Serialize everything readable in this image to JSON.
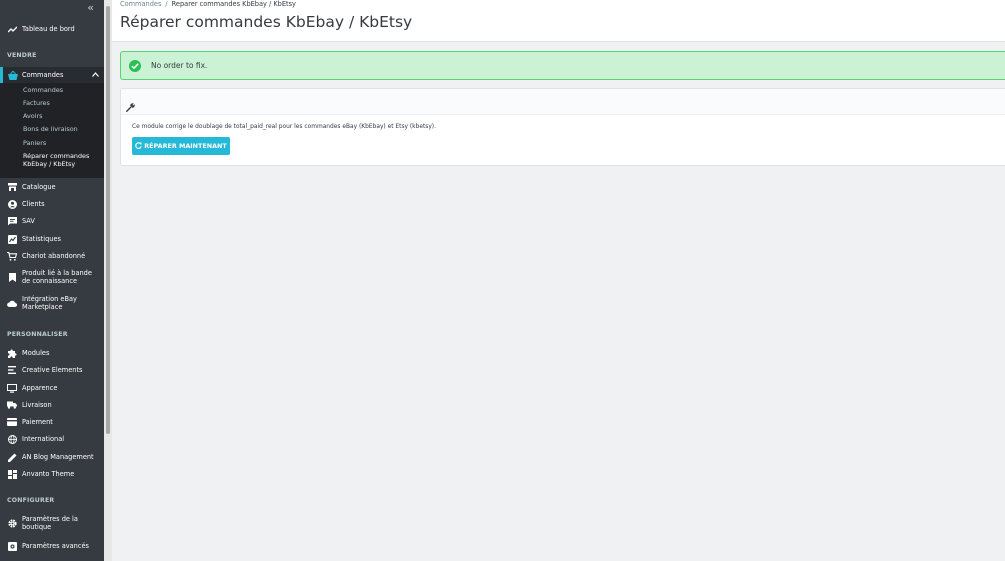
{
  "sidebar": {
    "collapse_icon": "«",
    "dashboard": "Tableau de bord",
    "sections": {
      "vendre": "VENDRE",
      "personnaliser": "PERSONNALISER",
      "configurer": "CONFIGURER"
    },
    "commandes": "Commandes",
    "submenu": [
      "Commandes",
      "Factures",
      "Avoirs",
      "Bons de livraison",
      "Paniers",
      "Réparer commandes KbEbay / KbEtsy"
    ],
    "vendre_items": [
      "Catalogue",
      "Clients",
      "SAV",
      "Statistiques",
      "Chariot abandonné",
      "Produit lié à la bande de connaissance",
      "Intégration eBay Marketplace"
    ],
    "personnaliser_items": [
      "Modules",
      "Creative Elements",
      "Apparence",
      "Livraison",
      "Paiement",
      "International",
      "AN Blog Management",
      "Anvanto Theme"
    ],
    "configurer_items": [
      "Paramètres de la boutique",
      "Paramètres avancés"
    ]
  },
  "header": {
    "breadcrumb_parent": "Commandes",
    "breadcrumb_sep": "/",
    "breadcrumb_current": "Reparer commandes KbEbay / KbEtsy",
    "title": "Réparer commandes KbEbay / KbEtsy"
  },
  "alert": {
    "message": "No order to fix."
  },
  "panel": {
    "description": "Ce module corrige le doublage de total_paid_real pour les commandes eBay (KbEbay) et Etsy (kbetsy).",
    "button_label": "RÉPARER MAINTENANT"
  },
  "colors": {
    "sidebar_bg": "#363a41",
    "accent": "#25b9d7",
    "success_bg": "#cbf2d4",
    "success_icon": "#2bbf54"
  }
}
